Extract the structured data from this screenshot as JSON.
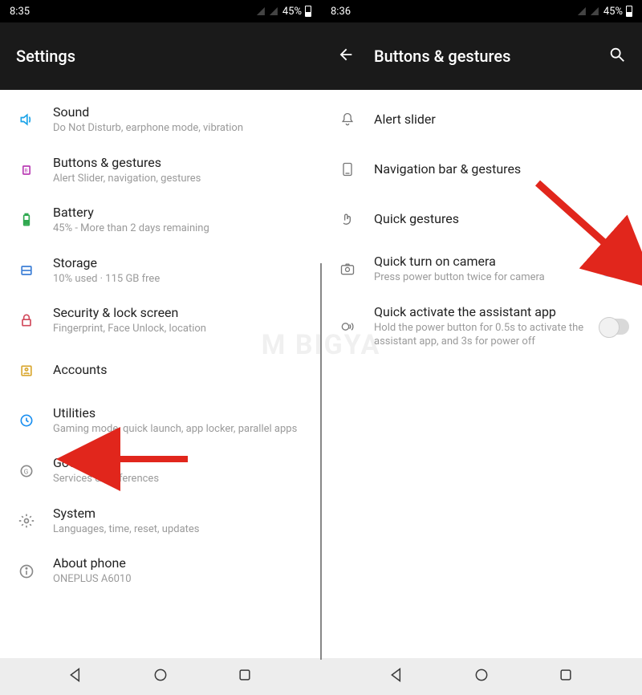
{
  "watermark": "M BIGYA",
  "left": {
    "status": {
      "time": "8:35",
      "battery": "45%"
    },
    "header": {
      "title": "Settings"
    },
    "items": [
      {
        "name": "sound",
        "title": "Sound",
        "sub": "Do Not Disturb, earphone mode, vibration",
        "iconColor": "#1aa3e8"
      },
      {
        "name": "buttons-gestures",
        "title": "Buttons & gestures",
        "sub": "Alert Slider, navigation, gestures",
        "iconColor": "#b93db4"
      },
      {
        "name": "battery",
        "title": "Battery",
        "sub": "45% - More than 2 days remaining",
        "iconColor": "#2fa84f"
      },
      {
        "name": "storage",
        "title": "Storage",
        "sub": "10% used · 115 GB free",
        "iconColor": "#3d7fd6"
      },
      {
        "name": "security",
        "title": "Security & lock screen",
        "sub": "Fingerprint, Face Unlock, location",
        "iconColor": "#d1495b"
      },
      {
        "name": "accounts",
        "title": "Accounts",
        "sub": "",
        "iconColor": "#d9a832"
      },
      {
        "name": "utilities",
        "title": "Utilities",
        "sub": "Gaming mode, quick launch, app locker, parallel apps",
        "iconColor": "#1a8ff0"
      },
      {
        "name": "google",
        "title": "Google",
        "sub": "Services & preferences",
        "iconColor": "#8a8a8a"
      },
      {
        "name": "system",
        "title": "System",
        "sub": "Languages, time, reset, updates",
        "iconColor": "#8a8a8a"
      },
      {
        "name": "about",
        "title": "About phone",
        "sub": "ONEPLUS A6010",
        "iconColor": "#8a8a8a"
      }
    ]
  },
  "right": {
    "status": {
      "time": "8:36",
      "battery": "45%"
    },
    "header": {
      "title": "Buttons & gestures"
    },
    "items": [
      {
        "name": "alert-slider",
        "title": "Alert slider",
        "sub": ""
      },
      {
        "name": "nav-bar",
        "title": "Navigation bar & gestures",
        "sub": ""
      },
      {
        "name": "quick-gestures",
        "title": "Quick gestures",
        "sub": ""
      },
      {
        "name": "quick-camera",
        "title": "Quick turn on camera",
        "sub": "Press power button twice for camera",
        "switch": "on"
      },
      {
        "name": "quick-assistant",
        "title": "Quick activate the assistant app",
        "sub": "Hold the power button for 0.5s to activate the assistant app, and 3s for power off",
        "switch": "off"
      }
    ]
  }
}
